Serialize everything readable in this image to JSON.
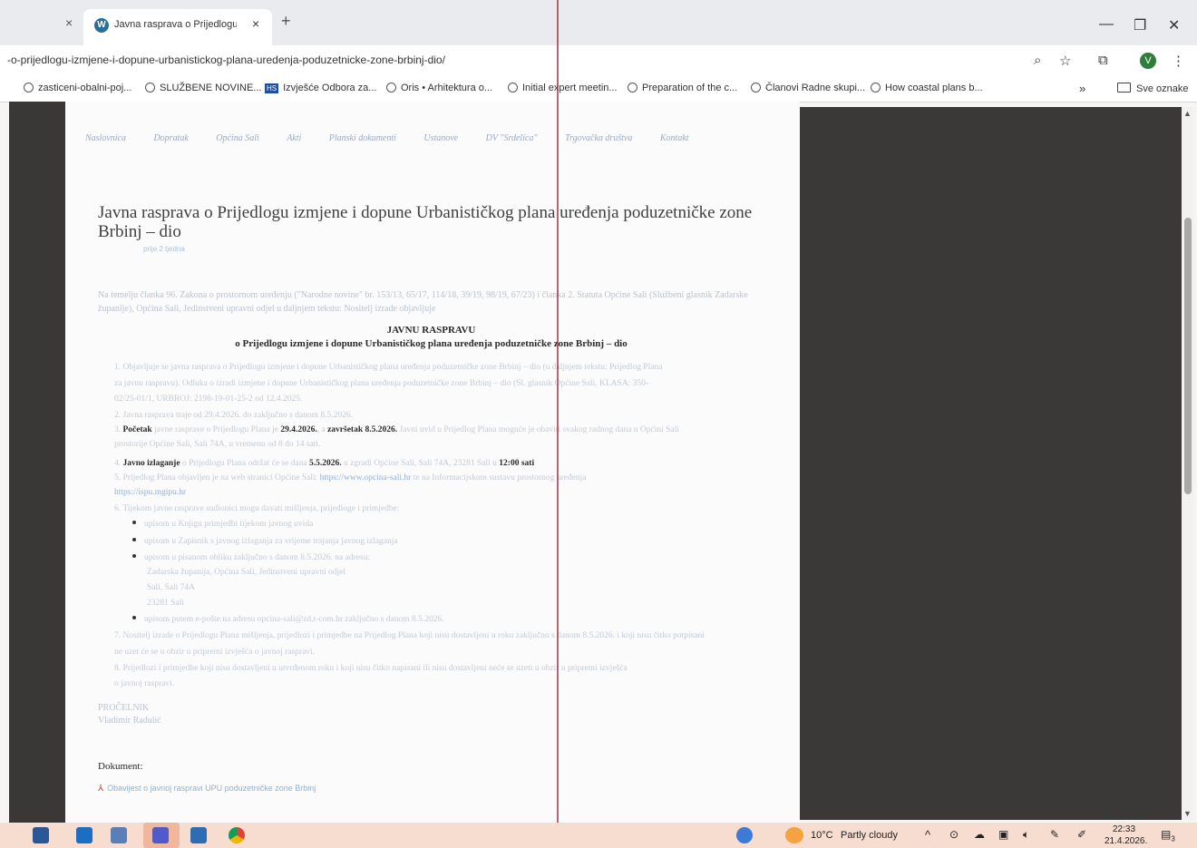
{
  "browser": {
    "tab_title": "Javna rasprava o Prijedlogu iz",
    "tab_close": "×",
    "prev_tab_close": "×",
    "new_tab": "+",
    "url": "-o-prijedlogu-izmjene-i-dopune-urbanistickog-plana-uredenja-poduzetnicke-zone-brbinj-dio/",
    "profile_initial": "V",
    "bookmarks": [
      "zasticeni-obalni-poj...",
      "SLUŽBENE NOVINE...",
      "Izvješće Odbora za...",
      "Oris • Arhitektura o...",
      "Initial expert meetin...",
      "Preparation of the c...",
      "Članovi Radne skupi...",
      "How coastal plans b..."
    ],
    "bookmarks_more": "»",
    "all_bookmarks": "Sve oznake"
  },
  "page": {
    "nav": [
      "Naslovnica",
      "Dopratak",
      "Općina Sali",
      "Akti",
      "Planski dokumenti",
      "Ustanove",
      "DV \"Srdelica\"",
      "Trgovačka društva",
      "Kontakt"
    ],
    "heading": "Javna rasprava o Prijedlogu izmjene i dopune Urbanističkog plana uređenja poduzetničke zone Brbinj – dio",
    "post_meta": "prije 2 tjedna",
    "intro": "Na temelju članka 96. Zakona o prostornom uređenju (\"Narodne novine\" br. 153/13, 65/17, 114/18, 39/19, 98/19, 67/23) i članka 2. Statuta Općine Sali (Službeni glasnik Zadarske županije), Općina Sali, Jedinstveni upravni odjel u daljnjem tekstu: Nositelj izrade objavljuje",
    "objava_title": "JAVNU RASPRAVU",
    "objava_subtitle": "o Prijedlogu izmjene i dopune Urbanističkog plana uređenja poduzetničke zone Brbinj – dio",
    "items": {
      "i1a": "1. Objavljuje se javna rasprava o Prijedlogu izmjene i dopune Urbanističkog plana uređenja poduzetničke zone Brbinj – dio (u daljnjem tekstu: Prijedlog Plana",
      "i1b": "za javnu raspravu). Odluka o izradi izmjene i dopune Urbanističkog plana uređenja poduzetničke zone Brbinj – dio (Sl. glasnik Općine Sali, KLASA: 350-",
      "i1c": "02/25-01/1, URBROJ: 2198-19-01-25-2 od 12.4.2025.",
      "i2": "2. Javna rasprava traje od 29.4.2026. do zaključno s danom 8.5.2026.",
      "i3_pre": "3. ",
      "i3_b1": "Početak",
      "i3_mid": " javne rasprave o Prijedlogu Plana je ",
      "i3_d1": "29.4.2026.",
      "i3_mid2": ", a ",
      "i3_b2": "završetak 8.5.2026.",
      "i3_rest": " Javni uvid u Prijedlog Plana moguće je obaviti svakog radnog dana u Općini Sali",
      "i3b": "prostorije Općine Sali, Sali 74A, u vremenu od 8 do 14 sati.",
      "i4_pre": "4. ",
      "i4_b1": "Javno izlaganje",
      "i4_mid": " o Prijedlogu Plana održat će se dana ",
      "i4_d1": "5.5.2026.",
      "i4_mid2": " u zgradi Općine Sali, Sali 74A, 23281 Sali u ",
      "i4_b2": "12:00 sati",
      "i5_pre": "5. Prijedlog Plana objavljen je na web stranici Općine Sali: ",
      "i5_link": "https://www.opcina-sali.hr",
      "i5_post": " te na Informacijskom sustavu prostornog uređenja",
      "i5b_link": "https://ispu.mgipu.hr",
      "i6": "6. Tijekom javne rasprave sudionici mogu davati mišljenja, prijedloge i primjedbe:",
      "b1": "upisom u Knjigu primjedbi tijekom javnog uvida",
      "b2": "upisom u Zapisnik s javnog izlaganja za vrijeme trajanja javnog izlaganja",
      "b3": "upisom u pisanom obliku zaključno s danom 8.5.2026. na adresu:",
      "addr1": "Zadarska županija, Općina Sali, Jedinstveni upravni odjel",
      "addr2": "Sali, Sali 74A",
      "addr3": "23281 Sali",
      "b4": "upisom putem e-pošte na adresu opcina-sali@zd.t-com.hr zaključno s danom 8.5.2026.",
      "i7a": "7. Nositelj izrade o Prijedlogu Plana mišljenja, prijedlozi i primjedbe na Prijedlog Plana koji nisu dostavljeni u roku zaključno s danom 8.5.2026. i koji nisu čitko potpisani",
      "i7b": "ne uzet će se u obzir u pripremi izvješća o javnoj raspravi.",
      "i8a": "8. Prijedlozi i primjedbe koji nisu dostavljeni u utvrđenom roku i koji nisu čitko napisani ili nisu dostavljeni neće se uzeti u obzir u pripremi izvješća",
      "i8b": "o javnoj raspravi."
    },
    "signature_role": "PROČELNIK",
    "signature_name": "Vladimir Radulić",
    "document_heading": "Dokument:",
    "document_link": "Obavijest o javnoj raspravi UPU poduzetničke zone Brbinj"
  },
  "taskbar": {
    "weather_temp": "10°C",
    "weather_text": "Partly cloudy",
    "time": "22:33",
    "date": "21.4.2026.",
    "notifications": "3"
  },
  "colors": {
    "dark_panel": "#3a3836",
    "taskbar": "#f7ddd0",
    "link": "#8fb0d6",
    "artifact_line": "#a4333d"
  }
}
